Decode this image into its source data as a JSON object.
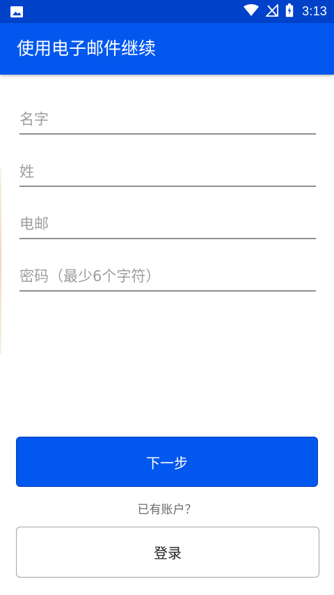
{
  "status_bar": {
    "time": "3:13",
    "icons": [
      "image-icon",
      "wifi-icon",
      "no-signal-icon",
      "battery-icon"
    ],
    "background_color": "#0042c9"
  },
  "app_bar": {
    "title": "使用电子邮件继续",
    "background_color": "#0257ee"
  },
  "form": {
    "first_name": {
      "value": "",
      "placeholder": "名字"
    },
    "last_name": {
      "value": "",
      "placeholder": "姓"
    },
    "email": {
      "value": "",
      "placeholder": "电邮"
    },
    "password": {
      "value": "",
      "placeholder": "密码（最少6个字符）"
    }
  },
  "actions": {
    "next_label": "下一步",
    "has_account_text": "已有账户？",
    "login_label": "登录"
  }
}
